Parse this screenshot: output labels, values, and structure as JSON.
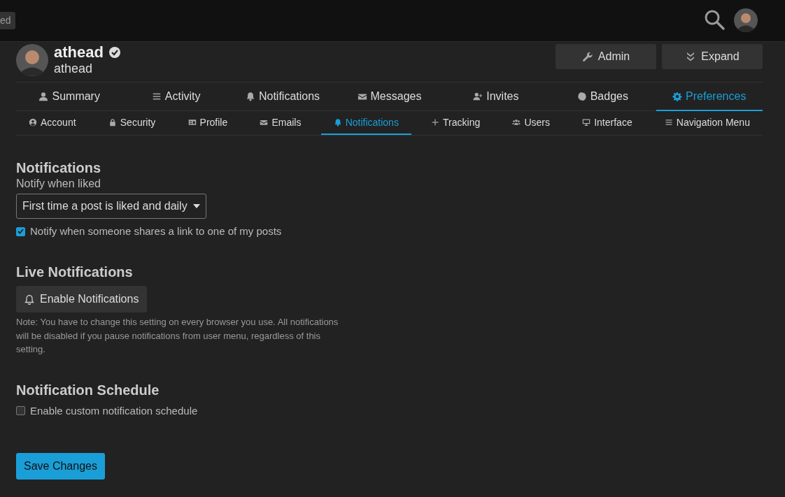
{
  "header": {
    "badge": "ed"
  },
  "profile": {
    "name": "athead",
    "username": "athead",
    "buttons": [
      {
        "label": "Admin",
        "kind": "wrench"
      },
      {
        "label": "Expand",
        "kind": "expand"
      }
    ]
  },
  "main_tabs": [
    {
      "label": "Summary",
      "kind": "user",
      "selected": false
    },
    {
      "label": "Activity",
      "kind": "lines",
      "selected": false
    },
    {
      "label": "Notifications",
      "kind": "bell",
      "selected": false
    },
    {
      "label": "Messages",
      "kind": "envelope",
      "selected": false
    },
    {
      "label": "Invites",
      "kind": "user-plus",
      "selected": false
    },
    {
      "label": "Badges",
      "kind": "badge",
      "selected": false
    },
    {
      "label": "Preferences",
      "kind": "gear",
      "selected": true
    }
  ],
  "sub_tabs": [
    {
      "label": "Account",
      "kind": "user-circle",
      "selected": false
    },
    {
      "label": "Security",
      "kind": "lock",
      "selected": false
    },
    {
      "label": "Profile",
      "kind": "id-card",
      "selected": false
    },
    {
      "label": "Emails",
      "kind": "envelope",
      "selected": false
    },
    {
      "label": "Notifications",
      "kind": "bell",
      "selected": true
    },
    {
      "label": "Tracking",
      "kind": "plus",
      "selected": false
    },
    {
      "label": "Users",
      "kind": "users",
      "selected": false
    },
    {
      "label": "Interface",
      "kind": "monitor",
      "selected": false
    },
    {
      "label": "Navigation Menu",
      "kind": "lines",
      "selected": false
    }
  ],
  "sections": [
    {
      "title": "Notifications",
      "items": [
        {
          "kind": "select",
          "label": "Notify when liked",
          "value": "First time a post is liked and daily"
        },
        {
          "kind": "checkbox",
          "label": "Notify when someone shares a link to one of my posts",
          "checked": true
        }
      ]
    },
    {
      "title": "Live Notifications",
      "items": [
        {
          "kind": "button",
          "label": "Enable Notifications"
        },
        {
          "kind": "note",
          "text": "Note: You have to change this setting on every browser you use. All notifications will be disabled if you pause notifications from user menu, regardless of this setting."
        }
      ]
    },
    {
      "title": "Notification Schedule",
      "items": [
        {
          "kind": "checkbox",
          "label": "Enable custom notification schedule",
          "checked": false
        }
      ]
    }
  ],
  "save_button": "Save Changes"
}
